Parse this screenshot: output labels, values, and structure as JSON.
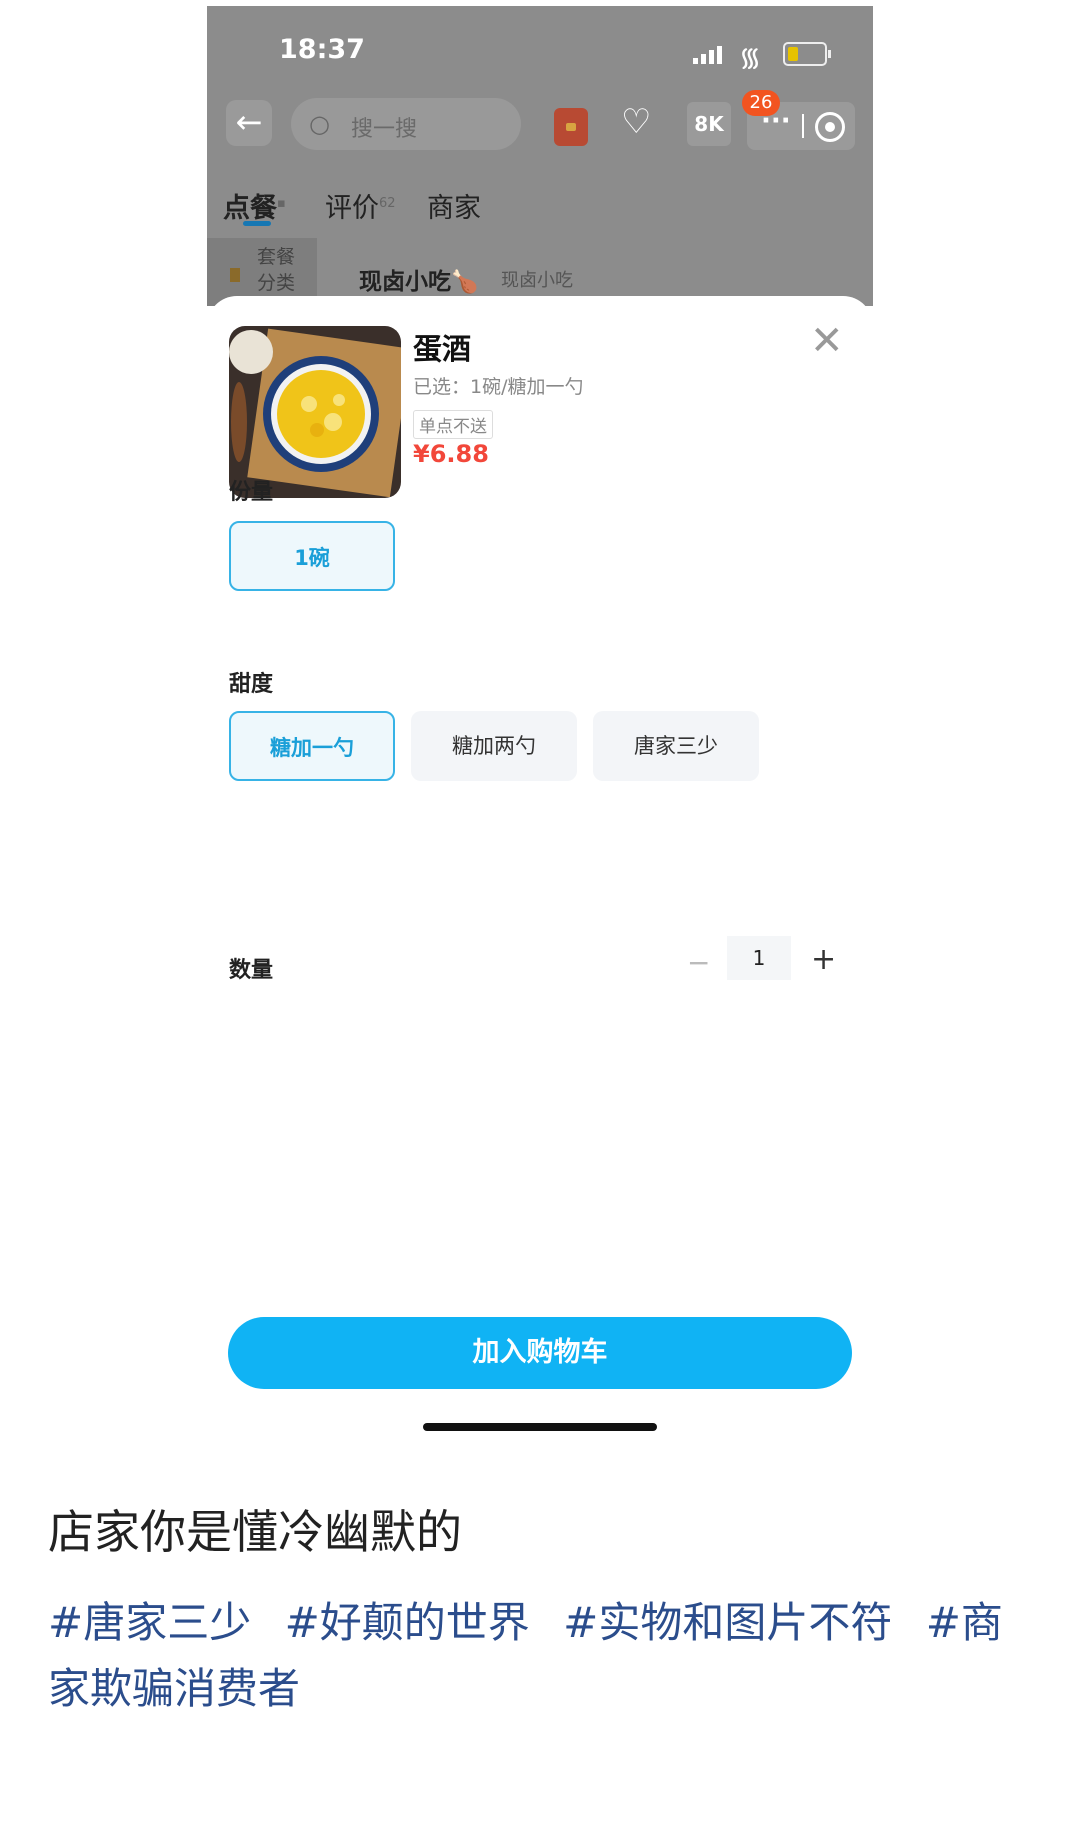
{
  "status_bar": {
    "time": "18:37"
  },
  "top_nav": {
    "search_placeholder": "搜一搜",
    "notification_badge": "26",
    "qr_label": "8K"
  },
  "tabs": [
    {
      "label": "点餐",
      "superscript": ""
    },
    {
      "label": "评价",
      "superscript": "62"
    },
    {
      "label": "商家",
      "superscript": ""
    }
  ],
  "category": {
    "side_label_line1": "套餐",
    "side_label_line2": "分类",
    "title": "现卤小吃",
    "subtitle": "现卤小吃"
  },
  "product": {
    "name": "蛋酒",
    "selected": "已选：1碗/糖加一勺",
    "tag": "单点不送",
    "price": "¥6.88"
  },
  "sections": {
    "portion": {
      "title": "份量",
      "options": [
        "1碗"
      ],
      "selected": "1碗"
    },
    "sweetness": {
      "title": "甜度",
      "options": [
        "糖加一勺",
        "糖加两勺",
        "唐家三少"
      ],
      "selected": "糖加一勺"
    },
    "quantity": {
      "title": "数量",
      "minus": "−",
      "value": "1",
      "plus": "+"
    }
  },
  "add_to_cart_label": "加入购物车",
  "post": {
    "caption": "店家你是懂冷幽默的",
    "hashtags": [
      "#唐家三少",
      "#好颠的世界",
      "#实物和图片不符",
      "#商家欺骗消费者"
    ]
  },
  "colors": {
    "accent": "#10b3f4",
    "price": "#f2473a",
    "hashtag": "#2b4d8c",
    "badge": "#f25420"
  }
}
